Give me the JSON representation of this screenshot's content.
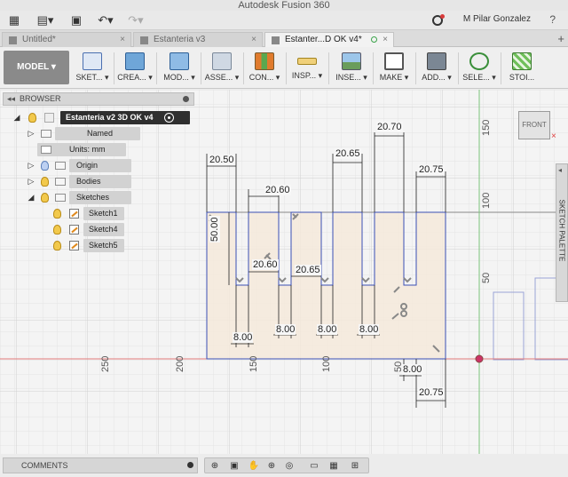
{
  "app": {
    "title": "Autodesk Fusion 360"
  },
  "qat": {
    "user_name": "M Pilar Gonzalez",
    "help": "?"
  },
  "tabs": [
    {
      "label": "Untitled*",
      "active": false
    },
    {
      "label": "Estanteria v3",
      "active": false
    },
    {
      "label": "Estanter...D OK v4*",
      "active": true
    }
  ],
  "ribbon": {
    "workspace": "MODEL ▾",
    "items": [
      {
        "label": "SKET... ▾",
        "icon": "sketch-icon"
      },
      {
        "label": "CREA... ▾",
        "icon": "create-icon"
      },
      {
        "label": "MOD... ▾",
        "icon": "modify-icon"
      },
      {
        "label": "ASSE... ▾",
        "icon": "assemble-icon"
      },
      {
        "label": "CON... ▾",
        "icon": "construct-icon"
      },
      {
        "label": "INSP... ▾",
        "icon": "inspect-icon"
      },
      {
        "label": "INSE... ▾",
        "icon": "insert-icon"
      },
      {
        "label": "MAKE ▾",
        "icon": "make-icon"
      },
      {
        "label": "ADD... ▾",
        "icon": "addins-icon"
      },
      {
        "label": "SELE... ▾",
        "icon": "select-icon"
      },
      {
        "label": "STOI...",
        "icon": "stop-sketch-icon"
      }
    ]
  },
  "browser": {
    "header": "BROWSER",
    "root": "Estanteria v2 3D OK v4",
    "nodes": {
      "named_views": "Named Views",
      "units": "Units: mm",
      "origin": "Origin",
      "bodies": "Bodies",
      "sketches": "Sketches",
      "sketch1": "Sketch1",
      "sketch4": "Sketch4",
      "sketch5": "Sketch5"
    }
  },
  "viewcube": {
    "face": "FRONT"
  },
  "sketch_palette": {
    "label": "SKETCH PALETTE"
  },
  "comments": {
    "label": "COMMENTS"
  },
  "canvas": {
    "horizontal_scale": [
      "250",
      "200",
      "150",
      "100",
      "50"
    ],
    "vertical_scale": [
      "150",
      "100",
      "50"
    ],
    "dimensions": {
      "d1": "20.50",
      "d2": "20.60",
      "d3": "20.65",
      "d4": "20.70",
      "d5": "20.75",
      "d6": "20.60",
      "d7": "20.65",
      "height": "50.00",
      "w1": "8.00",
      "w2": "8.00",
      "w3": "8.00",
      "w4": "8.00",
      "w5": "8.00",
      "bottom": "20.75"
    }
  },
  "colors": {
    "accent": "#2f2f2f",
    "sketch_fill": "#f5e9d9",
    "sketch_line": "#3a4fb5",
    "axis_red": "#e04040",
    "axis_green": "#3cb44b"
  }
}
